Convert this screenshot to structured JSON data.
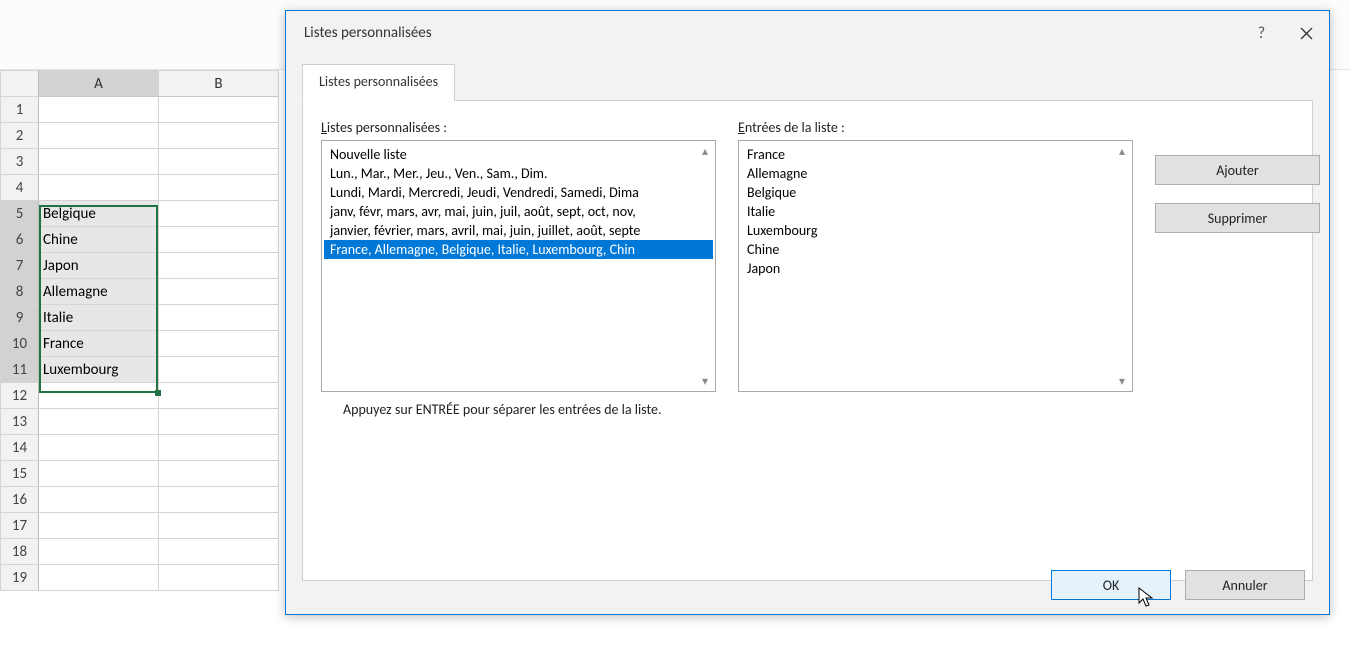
{
  "sheet": {
    "col_headers": [
      "A",
      "B"
    ],
    "rows": [
      1,
      2,
      3,
      4,
      5,
      6,
      7,
      8,
      9,
      10,
      11,
      12,
      13,
      14,
      15,
      16,
      17,
      18,
      19
    ],
    "cells": {
      "A5": "Belgique",
      "A6": "Chine",
      "A7": "Japon",
      "A8": "Allemagne",
      "A9": "Italie",
      "A10": "France",
      "A11": "Luxembourg"
    }
  },
  "dialog": {
    "title": "Listes personnalisées",
    "help_tooltip": "?",
    "tab_label": "Listes personnalisées",
    "left": {
      "label_pre": "L",
      "label_rest": "istes personnalisées :",
      "items": [
        "Nouvelle liste",
        "Lun., Mar., Mer., Jeu., Ven., Sam., Dim.",
        "Lundi, Mardi, Mercredi, Jeudi, Vendredi, Samedi, Dima",
        "janv, févr, mars, avr, mai, juin, juil, août, sept, oct, nov,",
        "janvier, février, mars, avril, mai, juin, juillet, août, septe",
        "France, Allemagne, Belgique, Italie, Luxembourg, Chin"
      ],
      "selected_index": 5
    },
    "right": {
      "label_pre": "E",
      "label_rest": "ntrées de la liste :",
      "items": [
        "France",
        "Allemagne",
        "Belgique",
        "Italie",
        "Luxembourg",
        "Chine",
        "Japon"
      ]
    },
    "buttons": {
      "add": "Ajouter",
      "remove": "Supprimer"
    },
    "hint": "Appuyez sur ENTRÉE pour séparer les entrées de la liste.",
    "footer": {
      "ok": "OK",
      "cancel": "Annuler"
    }
  }
}
